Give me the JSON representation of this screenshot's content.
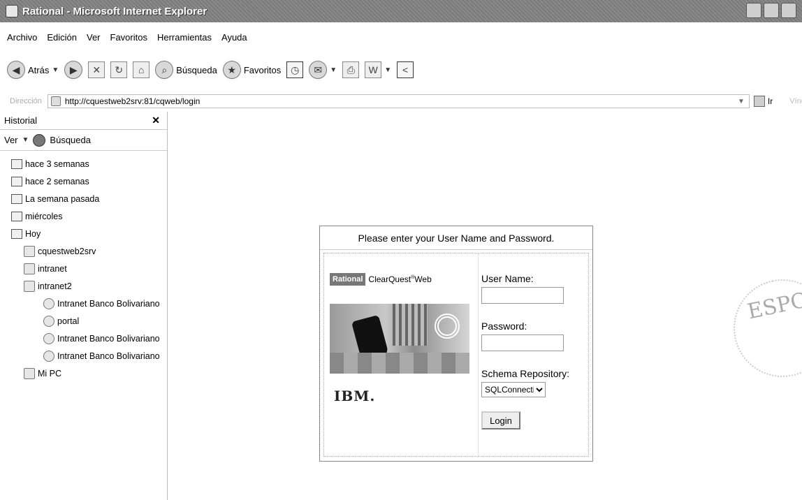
{
  "window": {
    "title": "Rational - Microsoft Internet Explorer"
  },
  "menu": [
    "Archivo",
    "Edición",
    "Ver",
    "Favoritos",
    "Herramientas",
    "Ayuda"
  ],
  "toolbar": {
    "back_label": "Atrás",
    "search_label": "Búsqueda",
    "favorites_label": "Favoritos"
  },
  "address": {
    "label": "Dirección",
    "url": "http://cquestweb2srv:81/cqweb/login",
    "go_label": "Ir",
    "links_label": "Vínculos"
  },
  "history": {
    "title": "Historial",
    "view_label": "Ver",
    "search_label": "Búsqueda",
    "items": [
      {
        "label": "hace 3 semanas"
      },
      {
        "label": "hace 2 semanas"
      },
      {
        "label": "La semana pasada"
      },
      {
        "label": "miércoles"
      },
      {
        "label": "Hoy"
      },
      {
        "label": "cquestweb2srv"
      },
      {
        "label": "intranet"
      },
      {
        "label": "intranet2"
      },
      {
        "label": "Intranet Banco Bolivariano"
      },
      {
        "label": "portal"
      },
      {
        "label": "Intranet Banco Bolivariano"
      },
      {
        "label": "Intranet Banco Bolivariano"
      },
      {
        "label": "Mi PC"
      }
    ]
  },
  "login": {
    "header": "Please enter your User Name and Password.",
    "brand_badge": "Rational",
    "brand_product": "ClearQuest",
    "brand_suffix": "Web",
    "ibm_logo": "IBM.",
    "user_label": "User Name:",
    "password_label": "Password:",
    "schema_label": "Schema Repository:",
    "schema_value": "SQLConnection",
    "login_button": "Login"
  },
  "stamp": {
    "text": "ESPO"
  }
}
